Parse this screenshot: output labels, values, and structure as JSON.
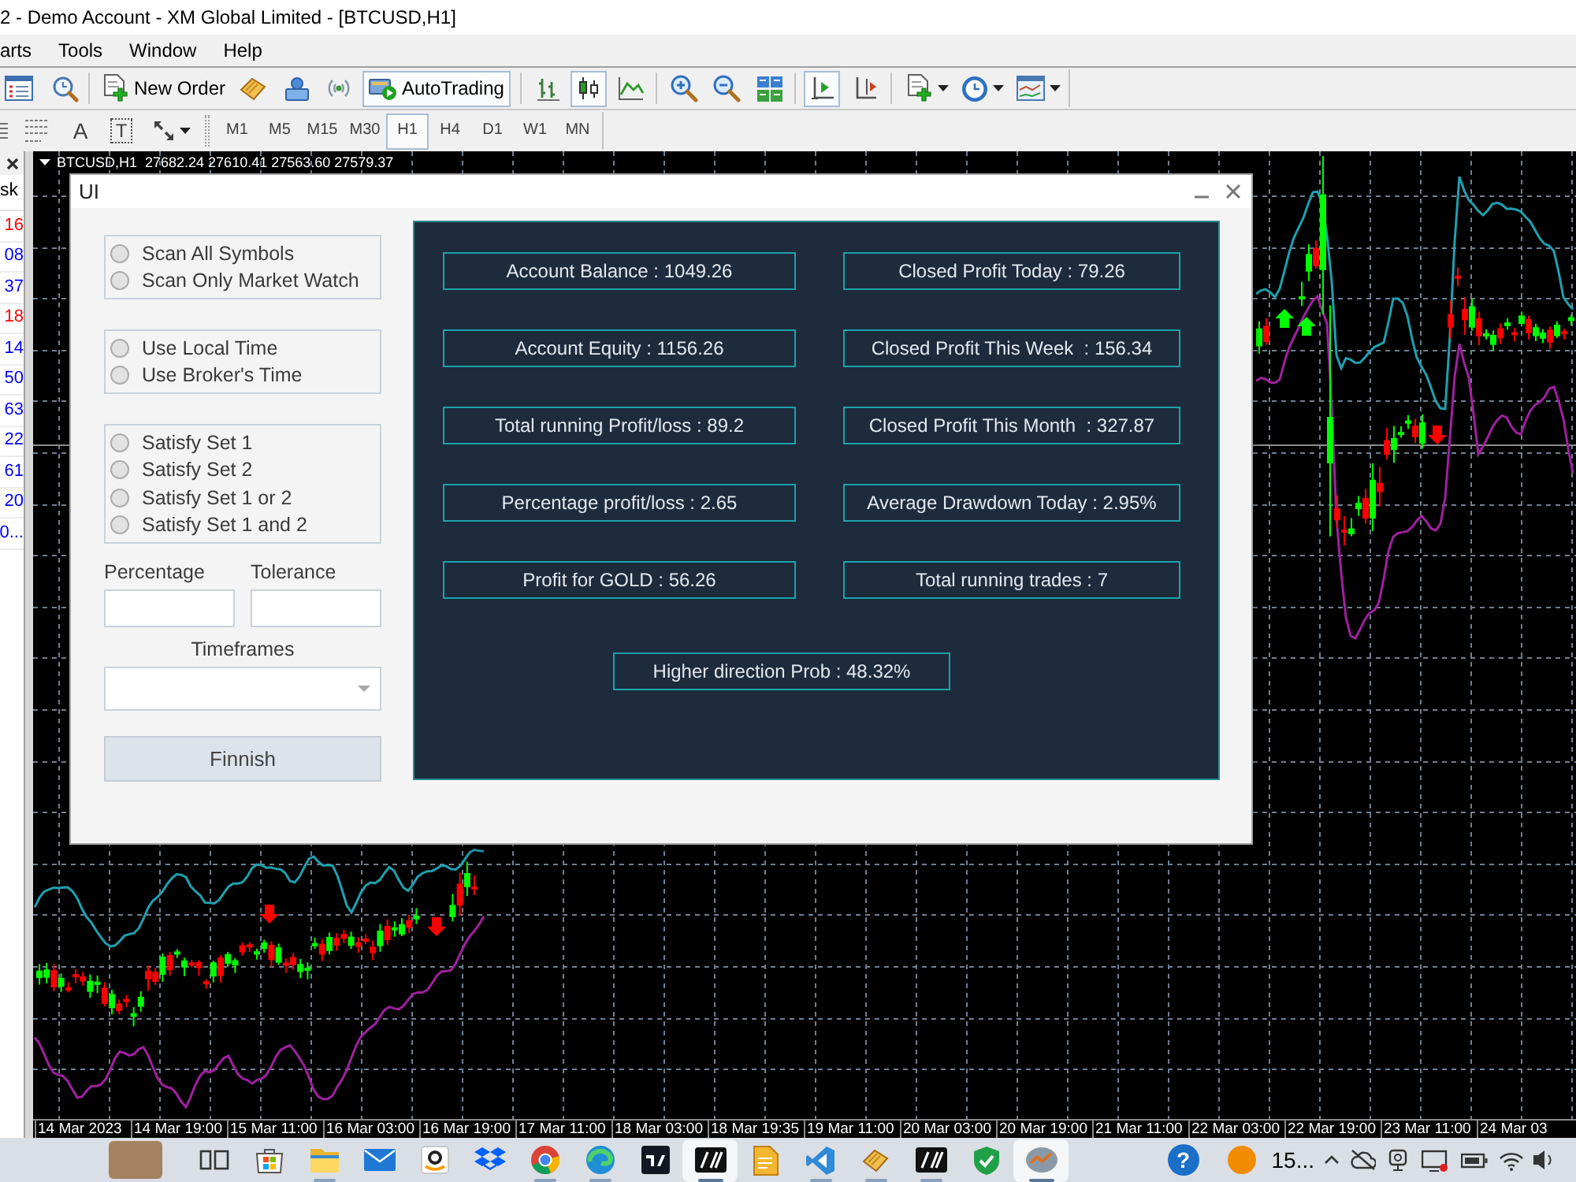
{
  "window": {
    "title": "2 - Demo Account - XM Global Limited - [BTCUSD,H1]"
  },
  "menu": [
    "arts",
    "Tools",
    "Window",
    "Help"
  ],
  "toolbar": {
    "new_order": "New Order",
    "autotrading": {
      "label": "AutoTrading",
      "on": true
    },
    "chart_types": [
      {
        "selected": false
      },
      {
        "selected": true
      },
      {
        "selected": false
      }
    ],
    "chart_shift": {
      "on": true
    },
    "autoscroll": {
      "on": false
    }
  },
  "toolbar_2": {
    "text_tools": [
      "A",
      "T"
    ],
    "timeframes": [
      {
        "label": "M1",
        "selected": false
      },
      {
        "label": "M5",
        "selected": false
      },
      {
        "label": "M15",
        "selected": false
      },
      {
        "label": "M30",
        "selected": false
      },
      {
        "label": "H1",
        "selected": true
      },
      {
        "label": "H4",
        "selected": false
      },
      {
        "label": "D1",
        "selected": false
      },
      {
        "label": "W1",
        "selected": false
      },
      {
        "label": "MN",
        "selected": false
      }
    ]
  },
  "market_watch": {
    "column": "sk",
    "rows": [
      {
        "text": "16",
        "color": "#ff0000"
      },
      {
        "text": "08",
        "color": "#0000ff"
      },
      {
        "text": "37",
        "color": "#0000ff"
      },
      {
        "text": "18",
        "color": "#ff0000"
      },
      {
        "text": "14",
        "color": "#0000ff"
      },
      {
        "text": "50",
        "color": "#0000ff"
      },
      {
        "text": "63",
        "color": "#0000ff"
      },
      {
        "text": "22",
        "color": "#0000ff"
      },
      {
        "text": "61",
        "color": "#0000ff"
      },
      {
        "text": "20",
        "color": "#0000ff"
      },
      {
        "text": "0...",
        "color": "#0000ff"
      }
    ]
  },
  "chart": {
    "header": "BTCUSD,H1  27682.24 27610.41 27563.60 27579.37",
    "time_axis": [
      "14 Mar 2023",
      "14 Mar 19:00",
      "15 Mar 11:00",
      "16 Mar 03:00",
      "16 Mar 19:00",
      "17 Mar 11:00",
      "18 Mar 03:00",
      "18 Mar 19:35",
      "19 Mar 11:00",
      "20 Mar 03:00",
      "20 Mar 19:00",
      "21 Mar 11:00",
      "22 Mar 03:00",
      "22 Mar 19:00",
      "23 Mar 11:00",
      "24 Mar 03"
    ]
  },
  "dialog": {
    "title": "UI",
    "radio_groups": [
      [
        {
          "label": "Scan All Symbols",
          "selected": false
        },
        {
          "label": "Scan Only Market Watch",
          "selected": false
        }
      ],
      [
        {
          "label": "Use Local Time",
          "selected": false
        },
        {
          "label": "Use Broker's Time",
          "selected": false
        }
      ],
      [
        {
          "label": "Satisfy Set 1",
          "selected": false
        },
        {
          "label": "Satisfy Set 2",
          "selected": false
        },
        {
          "label": "Satisfy Set 1 or 2",
          "selected": false
        },
        {
          "label": "Satisfy Set 1 and 2",
          "selected": false
        }
      ]
    ],
    "fields": [
      {
        "label": "Percentage"
      },
      {
        "label": "Tolerance"
      }
    ],
    "dropdown": {
      "label": "Timeframes"
    },
    "button": "Finnish",
    "stats": [
      [
        "Account Balance : 1049.26",
        "Closed Profit Today : 79.26"
      ],
      [
        "Account Equity : 1156.26",
        "Closed Profit This Week  : 156.34"
      ],
      [
        "Total running Profit/loss : 89.2",
        "Closed Profit This Month  : 327.87"
      ],
      [
        "Percentage profit/loss : 2.65",
        "Average Drawdown Today : 2.95%"
      ],
      [
        "Profit for GOLD : 56.26",
        "Total running trades : 7"
      ]
    ],
    "stats_footer": "Higher direction Prob : 48.32%"
  },
  "taskbar": {
    "apps": [
      {
        "kind": "photo",
        "running": false,
        "active": false
      },
      {
        "kind": "taskview",
        "running": false,
        "active": false
      },
      {
        "kind": "store",
        "running": false,
        "active": false
      },
      {
        "kind": "folder",
        "running": true,
        "active": false
      },
      {
        "kind": "mail",
        "running": false,
        "active": false
      },
      {
        "kind": "smile",
        "running": false,
        "active": false
      },
      {
        "kind": "diamonds",
        "running": false,
        "active": false
      },
      {
        "kind": "sphere",
        "running": true,
        "active": false
      },
      {
        "kind": "swirl",
        "running": true,
        "active": false
      },
      {
        "kind": "chart",
        "running": false,
        "active": false
      },
      {
        "kind": "tile",
        "running": true,
        "active": true
      },
      {
        "kind": "document",
        "running": false,
        "active": false
      },
      {
        "kind": "ribbon",
        "running": true,
        "active": false
      },
      {
        "kind": "book",
        "running": true,
        "active": false
      },
      {
        "kind": "tile",
        "running": true,
        "active": false
      },
      {
        "kind": "shield",
        "running": false,
        "active": false
      },
      {
        "kind": "gauge",
        "running": true,
        "active": true
      }
    ],
    "help": "?",
    "weather": "15..."
  }
}
